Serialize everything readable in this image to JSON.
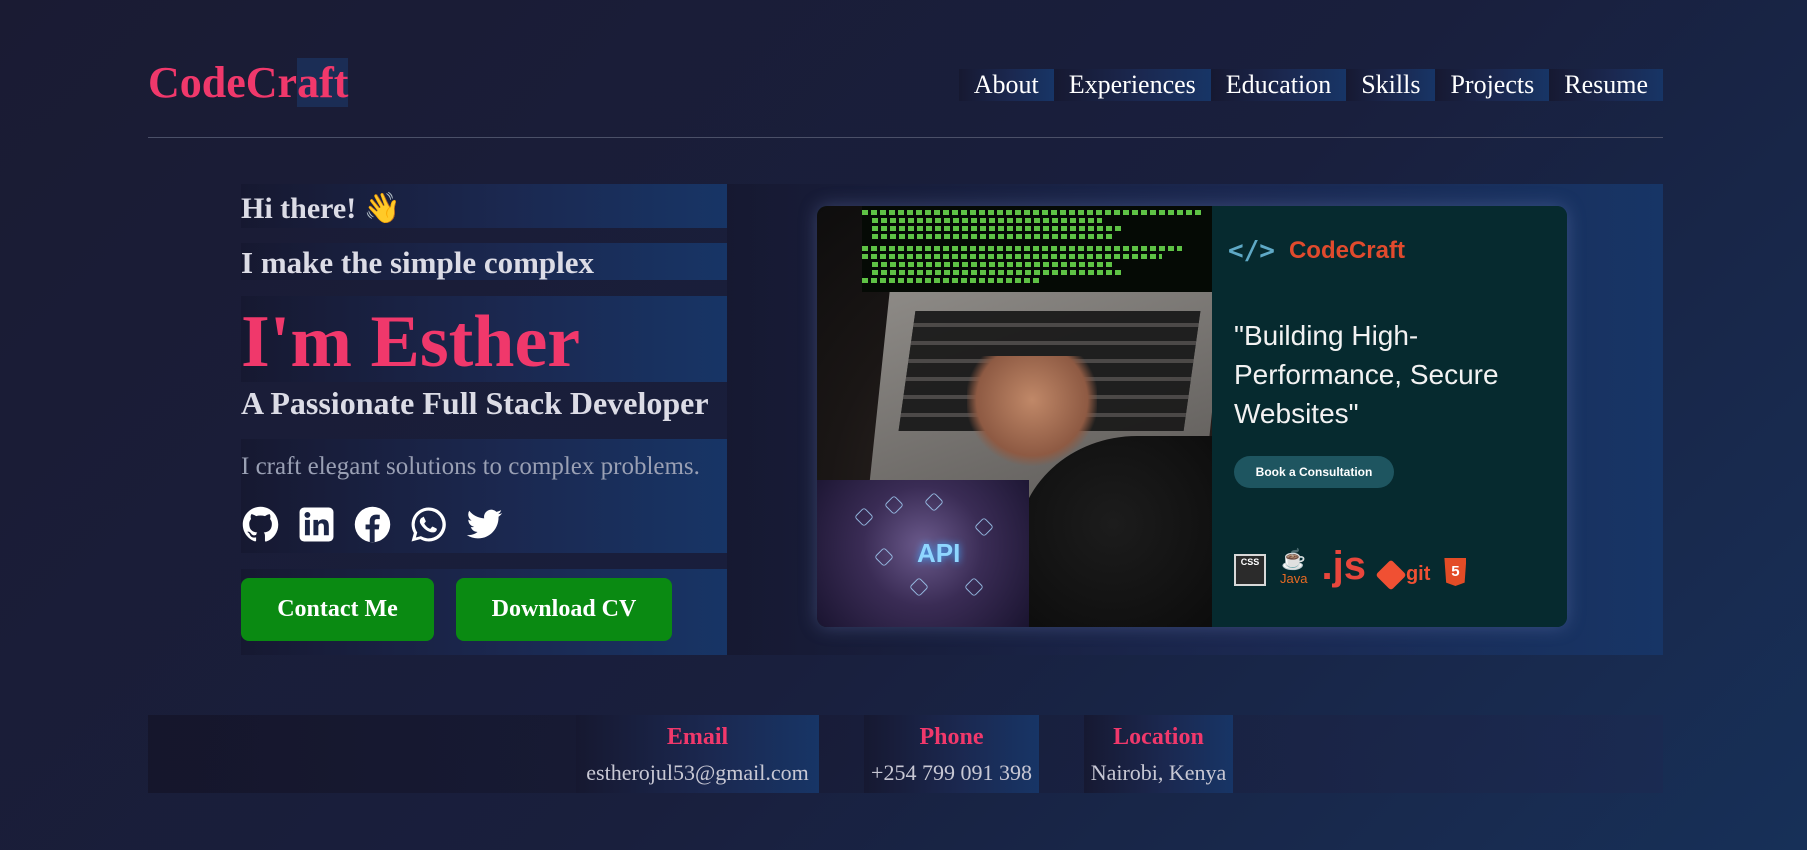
{
  "header": {
    "logo_head": "CodeCr",
    "logo_tail": "aft",
    "nav": [
      "About",
      "Experiences",
      "Education",
      "Skills",
      "Projects",
      "Resume"
    ]
  },
  "hero": {
    "greeting": "Hi there! 👋",
    "tagline": "I make the simple complex",
    "name": "I'm Esther",
    "role": "A Passionate Full Stack Developer",
    "blurb": "I craft elegant solutions to complex problems.",
    "socials": [
      "github-icon",
      "linkedin-icon",
      "facebook-icon",
      "whatsapp-icon",
      "twitter-icon"
    ],
    "buttons": {
      "contact": "Contact Me",
      "download": "Download CV"
    }
  },
  "banner": {
    "brand_code": "</>",
    "brand_name": "CodeCraft",
    "quote": "\"Building High-Performance, Secure Websites\"",
    "cta": "Book a Consultation",
    "api_text": "API",
    "tech": {
      "css": "CSS",
      "java": "Java",
      "js": ".js",
      "git": "git",
      "html": "5"
    }
  },
  "contact": {
    "email": {
      "label": "Email",
      "value": "estherojul53@gmail.com"
    },
    "phone": {
      "label": "Phone",
      "value": "+254 799 091 398"
    },
    "location": {
      "label": "Location",
      "value": "Nairobi, Kenya"
    }
  },
  "colors": {
    "accent": "#f0386b",
    "button": "#0a8a12",
    "background": "#1a1b33"
  }
}
